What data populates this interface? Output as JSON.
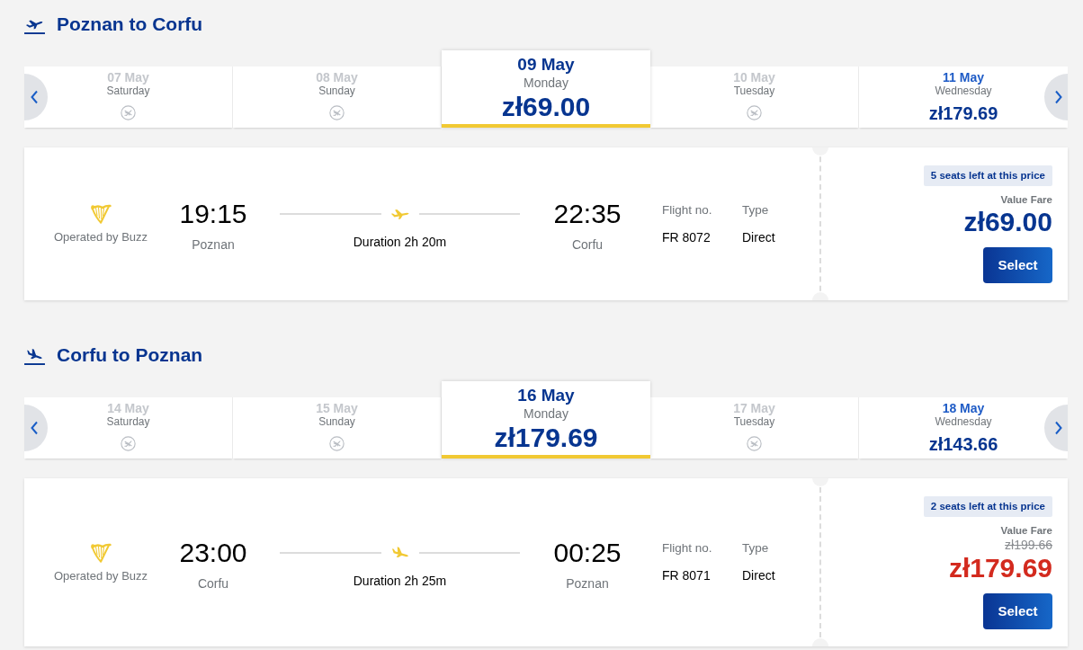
{
  "trips": [
    {
      "kind": "outbound",
      "title": "Poznan to Corfu",
      "dates": [
        {
          "date": "07 May",
          "day": "Saturday",
          "available": false,
          "selected": false
        },
        {
          "date": "08 May",
          "day": "Sunday",
          "available": false,
          "selected": false
        },
        {
          "date": "09 May",
          "day": "Monday",
          "available": true,
          "price": "zł69.00",
          "selected": true
        },
        {
          "date": "10 May",
          "day": "Tuesday",
          "available": false,
          "selected": false
        },
        {
          "date": "11 May",
          "day": "Wednesday",
          "available": true,
          "price": "zł179.69",
          "selected": false
        }
      ],
      "flight": {
        "operator": "Operated by Buzz",
        "departure_time": "19:15",
        "departure_city": "Poznan",
        "duration": "Duration 2h 20m",
        "arrival_time": "22:35",
        "arrival_city": "Corfu",
        "flight_no_label": "Flight no.",
        "flight_no": "FR 8072",
        "type_label": "Type",
        "type": "Direct"
      },
      "fare": {
        "badge": "5 seats left at this price",
        "name": "Value Fare",
        "discounted": false,
        "price": "zł69.00",
        "button": "Select"
      }
    },
    {
      "kind": "return",
      "title": "Corfu to Poznan",
      "dates": [
        {
          "date": "14 May",
          "day": "Saturday",
          "available": false,
          "selected": false
        },
        {
          "date": "15 May",
          "day": "Sunday",
          "available": false,
          "selected": false
        },
        {
          "date": "16 May",
          "day": "Monday",
          "available": true,
          "price": "zł179.69",
          "selected": true
        },
        {
          "date": "17 May",
          "day": "Tuesday",
          "available": false,
          "selected": false
        },
        {
          "date": "18 May",
          "day": "Wednesday",
          "available": true,
          "price": "zł143.66",
          "selected": false
        }
      ],
      "flight": {
        "operator": "Operated by Buzz",
        "departure_time": "23:00",
        "departure_city": "Corfu",
        "duration": "Duration 2h 25m",
        "arrival_time": "00:25",
        "arrival_city": "Poznan",
        "flight_no_label": "Flight no.",
        "flight_no": "FR 8071",
        "type_label": "Type",
        "type": "Direct"
      },
      "fare": {
        "badge": "2 seats left at this price",
        "name": "Value Fare",
        "discounted": true,
        "old_price": "zł199.66",
        "price": "zł179.69",
        "button": "Select"
      }
    }
  ]
}
